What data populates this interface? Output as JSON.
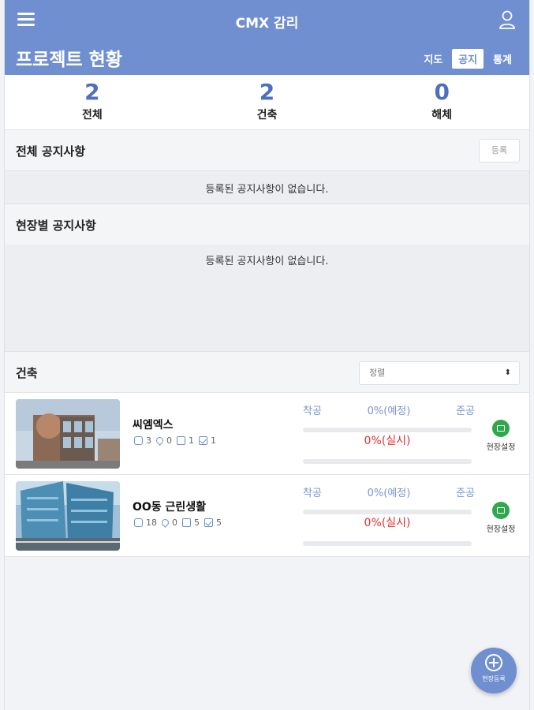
{
  "header": {
    "app_title": "CMX 감리",
    "page_title": "프로젝트 현황",
    "view_tabs": [
      {
        "label": "지도",
        "active": false
      },
      {
        "label": "공지",
        "active": true
      },
      {
        "label": "통계",
        "active": false
      }
    ]
  },
  "stats": [
    {
      "value": "2",
      "label": "전체"
    },
    {
      "value": "2",
      "label": "건축"
    },
    {
      "value": "0",
      "label": "해체"
    }
  ],
  "notices": {
    "all_title": "전체 공지사항",
    "register_label": "등록",
    "all_empty": "등록된 공지사항이 없습니다.",
    "site_title": "현장별 공지사항",
    "site_empty": "등록된 공지사항이 없습니다."
  },
  "projects_section": {
    "title": "건축",
    "sort_placeholder": "정렬",
    "sort_arrow": "⬍"
  },
  "projects": [
    {
      "name": "씨엠엑스",
      "photos": "3",
      "locations": "0",
      "documents": "1",
      "checks": "1",
      "start_label": "착공",
      "planned": "0%(예정)",
      "end_label": "준공",
      "actual": "0%(실시)",
      "setting_label": "현장설정"
    },
    {
      "name": "OO동 근린생활",
      "photos": "18",
      "locations": "0",
      "documents": "5",
      "checks": "5",
      "start_label": "착공",
      "planned": "0%(예정)",
      "end_label": "준공",
      "actual": "0%(실시)",
      "setting_label": "현장설정"
    }
  ],
  "fab": {
    "label": "현장등록"
  },
  "icons": {
    "menu": "menu-icon",
    "user": "user-icon",
    "photo": "camera-icon",
    "location": "pin-icon",
    "document": "document-icon",
    "check": "checkbox-icon",
    "site_setting": "folder-icon",
    "fab": "plus-circle-icon"
  },
  "colors": {
    "header": "#6f8fd0",
    "stat_number": "#4c6fbf",
    "progress_label": "#7a95cf",
    "actual_text": "#e03030",
    "site_icon": "#2ea84a"
  }
}
